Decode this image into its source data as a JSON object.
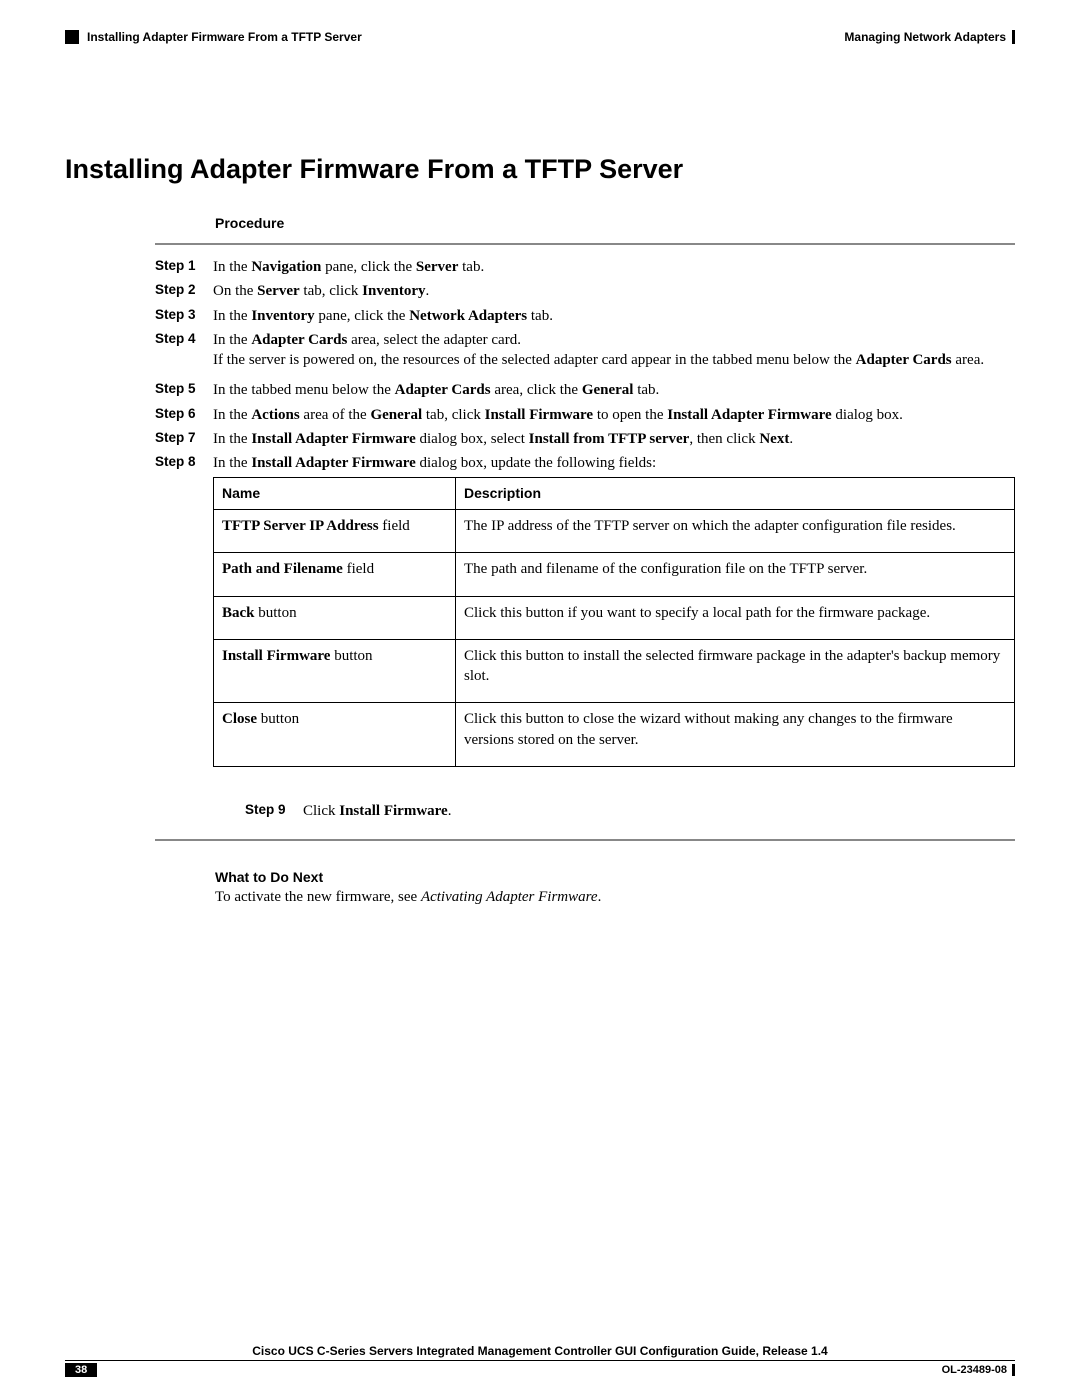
{
  "header": {
    "left": "Installing Adapter Firmware From a TFTP Server",
    "right": "Managing Network Adapters"
  },
  "title": "Installing Adapter Firmware From a TFTP Server",
  "procedure_label": "Procedure",
  "steps": {
    "s1_label": "Step 1",
    "s1_a": "In the ",
    "s1_b": "Navigation",
    "s1_c": " pane, click the ",
    "s1_d": "Server",
    "s1_e": " tab.",
    "s2_label": "Step 2",
    "s2_a": "On the ",
    "s2_b": "Server",
    "s2_c": " tab, click ",
    "s2_d": "Inventory",
    "s2_e": ".",
    "s3_label": "Step 3",
    "s3_a": "In the ",
    "s3_b": "Inventory",
    "s3_c": " pane, click the ",
    "s3_d": "Network Adapters",
    "s3_e": " tab.",
    "s4_label": "Step 4",
    "s4_a": "In the ",
    "s4_b": "Adapter Cards",
    "s4_c": " area, select the adapter card.",
    "s4_d": "If the server is powered on, the resources of the selected adapter card appear in the tabbed menu below the ",
    "s4_e": "Adapter Cards",
    "s4_f": " area.",
    "s5_label": "Step 5",
    "s5_a": "In the tabbed menu below the ",
    "s5_b": "Adapter Cards",
    "s5_c": " area, click the ",
    "s5_d": "General",
    "s5_e": " tab.",
    "s6_label": "Step 6",
    "s6_a": "In the ",
    "s6_b": "Actions",
    "s6_c": " area of the ",
    "s6_d": "General",
    "s6_e": " tab, click ",
    "s6_f": "Install Firmware",
    "s6_g": " to open the ",
    "s6_h": "Install Adapter Firmware",
    "s6_i": " dialog box.",
    "s7_label": "Step 7",
    "s7_a": "In the ",
    "s7_b": "Install Adapter Firmware",
    "s7_c": " dialog box, select ",
    "s7_d": "Install from TFTP server",
    "s7_e": ", then click ",
    "s7_f": "Next",
    "s7_g": ".",
    "s8_label": "Step 8",
    "s8_a": "In the ",
    "s8_b": "Install Adapter Firmware",
    "s8_c": " dialog box, update the following fields:",
    "s9_label": "Step 9",
    "s9_a": "Click ",
    "s9_b": "Install Firmware",
    "s9_c": "."
  },
  "table": {
    "h_name": "Name",
    "h_desc": "Description",
    "r1_name_a": "TFTP Server IP Address",
    "r1_name_b": " field",
    "r1_desc": "The IP address of the TFTP server on which the adapter configuration file resides.",
    "r2_name_a": "Path and Filename",
    "r2_name_b": " field",
    "r2_desc": "The path and filename of the configuration file on the TFTP server.",
    "r3_name_a": "Back",
    "r3_name_b": " button",
    "r3_desc": "Click this button if you want to specify a local path for the firmware package.",
    "r4_name_a": "Install Firmware",
    "r4_name_b": " button",
    "r4_desc": "Click this button to install the selected firmware package in the adapter's backup memory slot.",
    "r5_name_a": "Close",
    "r5_name_b": " button",
    "r5_desc": "Click this button to close the wizard without making any changes to the firmware versions stored on the server."
  },
  "what_next": {
    "heading": "What to Do Next",
    "body_a": "To activate the new firmware, see ",
    "body_b": "Activating Adapter Firmware",
    "body_c": "."
  },
  "footer": {
    "title": "Cisco UCS C-Series Servers Integrated Management Controller GUI Configuration Guide, Release 1.4",
    "page": "38",
    "docid": "OL-23489-08"
  }
}
